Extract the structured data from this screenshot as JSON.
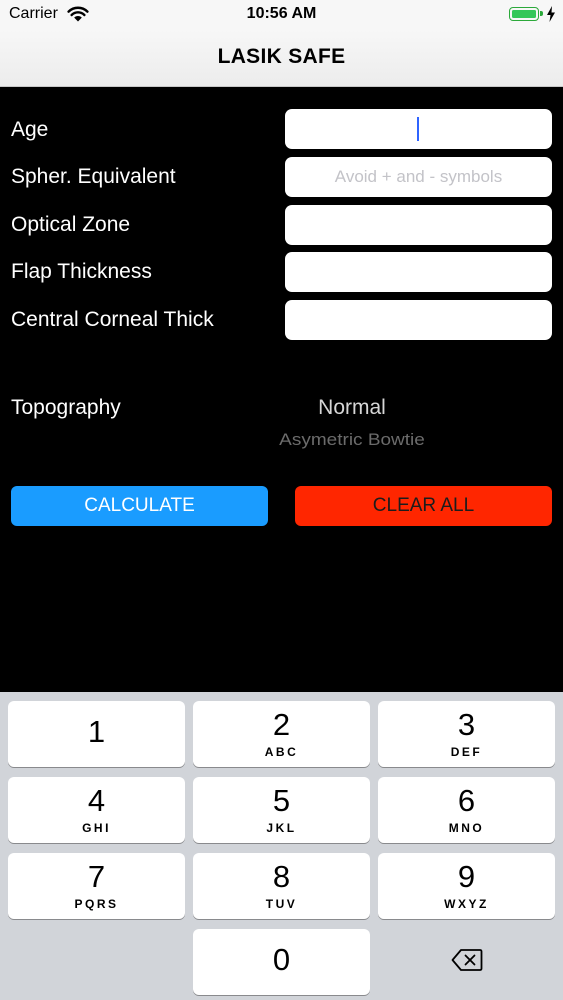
{
  "status_bar": {
    "carrier": "Carrier",
    "time": "10:56 AM",
    "wifi_icon": "wifi-icon",
    "battery_icon": "battery-icon",
    "charging_icon": "charging-bolt-icon"
  },
  "nav": {
    "title": "LASIK SAFE"
  },
  "form": {
    "age": {
      "label": "Age",
      "value": ""
    },
    "spherical_equivalent": {
      "label": "Spher. Equivalent",
      "value": "",
      "placeholder": "Avoid + and - symbols"
    },
    "optical_zone": {
      "label": "Optical Zone",
      "value": ""
    },
    "flap_thickness": {
      "label": "Flap Thickness",
      "value": ""
    },
    "central_corneal_thick": {
      "label": "Central Corneal Thick",
      "value": ""
    }
  },
  "topography": {
    "label": "Topography",
    "options": [
      "Normal",
      "Asymetric Bowtie"
    ],
    "selected": "Normal",
    "next": "Asymetric Bowtie"
  },
  "actions": {
    "calculate": "CALCULATE",
    "clear_all": "CLEAR ALL"
  },
  "colors": {
    "calculate": "#1a9cff",
    "clear_all": "#ff2600",
    "background": "#000000",
    "caret": "#2f64ff"
  },
  "keyboard": {
    "keys": [
      {
        "digit": "1",
        "letters": ""
      },
      {
        "digit": "2",
        "letters": "ABC"
      },
      {
        "digit": "3",
        "letters": "DEF"
      },
      {
        "digit": "4",
        "letters": "GHI"
      },
      {
        "digit": "5",
        "letters": "JKL"
      },
      {
        "digit": "6",
        "letters": "MNO"
      },
      {
        "digit": "7",
        "letters": "PQRS"
      },
      {
        "digit": "8",
        "letters": "TUV"
      },
      {
        "digit": "9",
        "letters": "WXYZ"
      },
      {
        "digit": "0",
        "letters": ""
      }
    ],
    "delete_icon": "backspace-icon"
  }
}
